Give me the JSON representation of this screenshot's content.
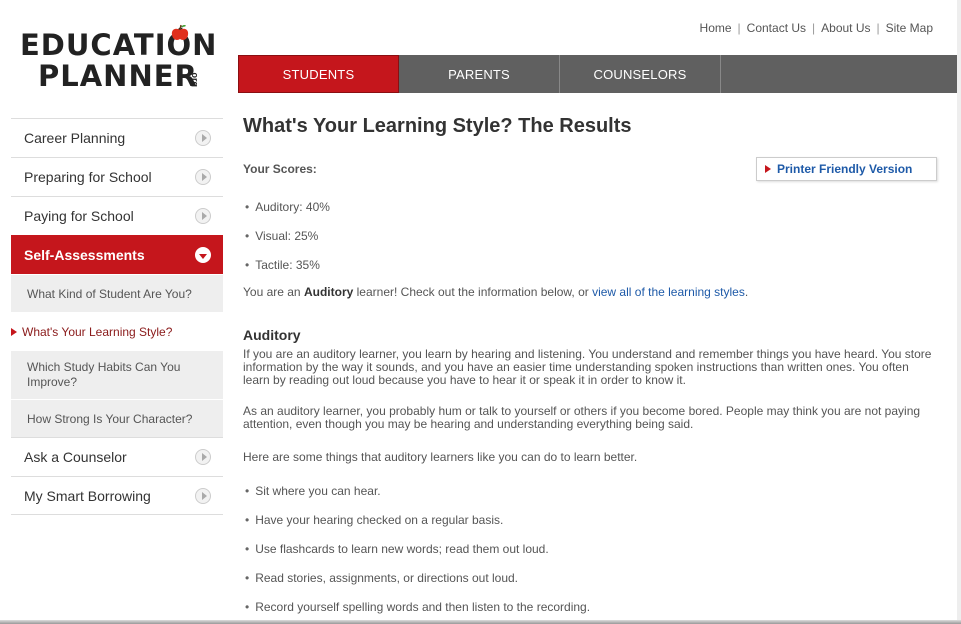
{
  "logo": {
    "line1": "EDUCATIÓN",
    "line2": "PLANNER",
    "org": ".org"
  },
  "top_links": [
    "Home",
    "Contact Us",
    "About Us",
    "Site Map"
  ],
  "main_nav": [
    {
      "label": "STUDENTS",
      "active": true
    },
    {
      "label": "PARENTS",
      "active": false
    },
    {
      "label": "COUNSELORS",
      "active": false
    }
  ],
  "sidebar": {
    "career": "Career Planning",
    "preparing": "Preparing for School",
    "paying": "Paying for School",
    "self": "Self-Assessments",
    "sub_kind": "What Kind of Student Are You?",
    "sub_style": "What's Your Learning Style?",
    "sub_habits": "Which Study Habits Can You Improve?",
    "sub_character": "How Strong Is Your Character?",
    "ask": "Ask a Counselor",
    "borrowing": "My Smart Borrowing"
  },
  "main": {
    "title": "What's Your Learning Style? The Results",
    "scores_label": "Your Scores:",
    "printer": "Printer Friendly Version",
    "scores": [
      "Auditory: 40%",
      "Visual: 25%",
      "Tactile: 35%"
    ],
    "summary_pre": "You are an ",
    "summary_bold": "Auditory",
    "summary_mid": " learner! Check out the information below, or ",
    "summary_link": "view all of the learning styles",
    "summary_end": ".",
    "section_heading": "Auditory",
    "para1": "If you are an auditory learner, you learn by hearing and listening. You understand and remember things you have heard. You store information by the way it sounds, and you have an easier time understanding spoken instructions than written ones. You often learn by reading out loud because you have to hear it or speak it in order to know it.",
    "para2": "As an auditory learner, you probably hum or talk to yourself or others if you become bored. People may think you are not paying attention, even though you may be hearing and understanding everything being said.",
    "para3": "Here are some things that auditory learners like you can do to learn better.",
    "tips": [
      "Sit where you can hear.",
      "Have your hearing checked on a regular basis.",
      "Use flashcards to learn new words; read them out loud.",
      "Read stories, assignments, or directions out loud.",
      "Record yourself spelling words and then listen to the recording."
    ]
  },
  "colors": {
    "accent_red": "#c5161c",
    "nav_gray": "#606060",
    "link_blue": "#1e5aa8"
  }
}
